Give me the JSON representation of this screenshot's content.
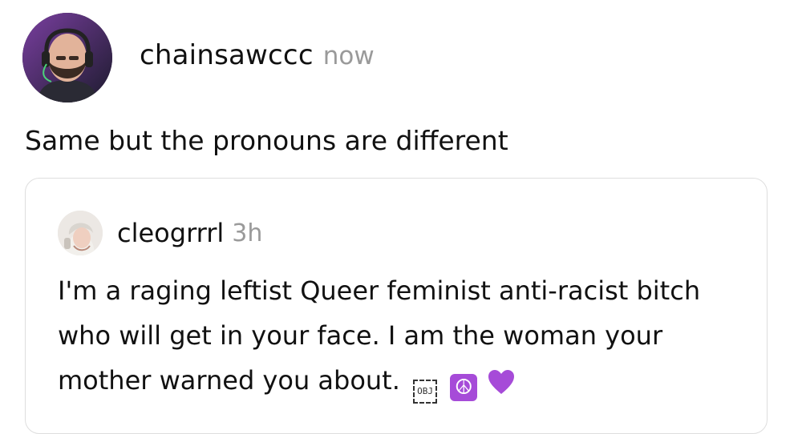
{
  "post": {
    "author": "chainsawccc",
    "time": "now",
    "text": "Same but the pronouns are different"
  },
  "quoted_post": {
    "author": "cleogrrrl",
    "time": "3h",
    "text": "I'm a raging leftist Queer feminist anti-racist bitch who will get in your face. I am the woman your mother warned you about.",
    "emoji_placeholder": "OBJ",
    "emojis": [
      "peace-symbol",
      "purple-heart"
    ]
  },
  "colors": {
    "text": "#111111",
    "muted": "#9a9a9a",
    "card_border": "#dedede",
    "peace_bg": "#a64bd8",
    "heart": "#a64bd8"
  }
}
